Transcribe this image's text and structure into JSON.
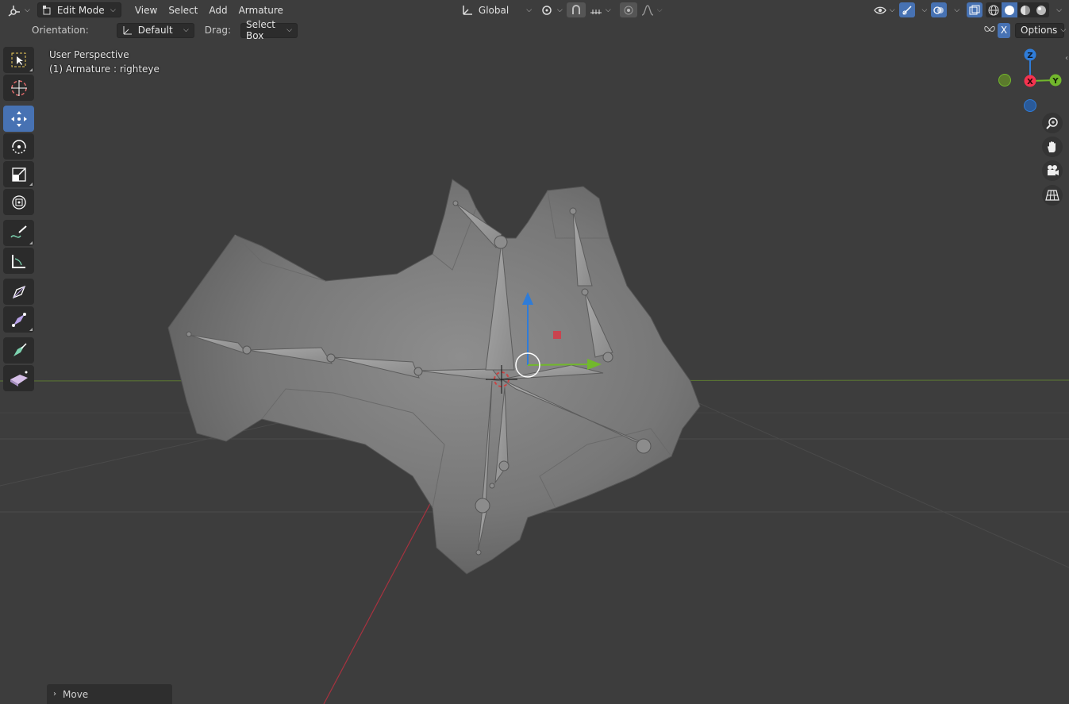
{
  "header": {
    "editor_type_icon": "3d-viewport-icon",
    "mode_label": "Edit Mode",
    "menus": [
      "View",
      "Select",
      "Add",
      "Armature"
    ],
    "transform_orientation": "Global",
    "pivot_icon": "pivot-icon",
    "snap_icon": "snap-icon",
    "proportional_icon": "proportional-edit-icon",
    "falloff_icon": "falloff-curve-icon",
    "visibility_icon": "eye-icon",
    "gizmo_icon": "gizmo-icon",
    "overlay_icon": "overlay-icon",
    "xray_icon": "xray-icon",
    "shading_modes": [
      "wireframe",
      "solid",
      "material",
      "rendered"
    ],
    "active_shading": "solid"
  },
  "tool_settings": {
    "orientation_label": "Orientation:",
    "orientation_value": "Default",
    "drag_label": "Drag:",
    "drag_value": "Select Box",
    "mirror_x_label": "X",
    "options_label": "Options"
  },
  "toolbar": {
    "tools": [
      {
        "name": "select-box-icon",
        "active": false
      },
      {
        "name": "cursor-icon",
        "active": false
      },
      {
        "name": "move-icon",
        "active": true
      },
      {
        "name": "rotate-icon",
        "active": false
      },
      {
        "name": "scale-icon",
        "active": false
      },
      {
        "name": "transform-icon",
        "active": false
      },
      {
        "name": "annotate-icon",
        "active": false
      },
      {
        "name": "measure-icon",
        "active": false
      },
      {
        "name": "roll-icon",
        "active": false
      },
      {
        "name": "bone-size-icon",
        "active": false
      },
      {
        "name": "extrude-icon",
        "active": false
      },
      {
        "name": "bone-envelope-icon",
        "active": false
      }
    ]
  },
  "viewport": {
    "perspective_label": "User Perspective",
    "object_label": "(1) Armature : righteye"
  },
  "nav_gizmo": {
    "z_label": "Z",
    "x_label": "X",
    "y_label": "Y",
    "colors": {
      "x": "#f5334f",
      "y": "#72b82c",
      "z": "#2f7cd8"
    }
  },
  "nav_buttons": [
    "zoom-icon",
    "pan-hand-icon",
    "camera-icon",
    "ortho-grid-icon"
  ],
  "operator_panel": {
    "label": "Move"
  }
}
